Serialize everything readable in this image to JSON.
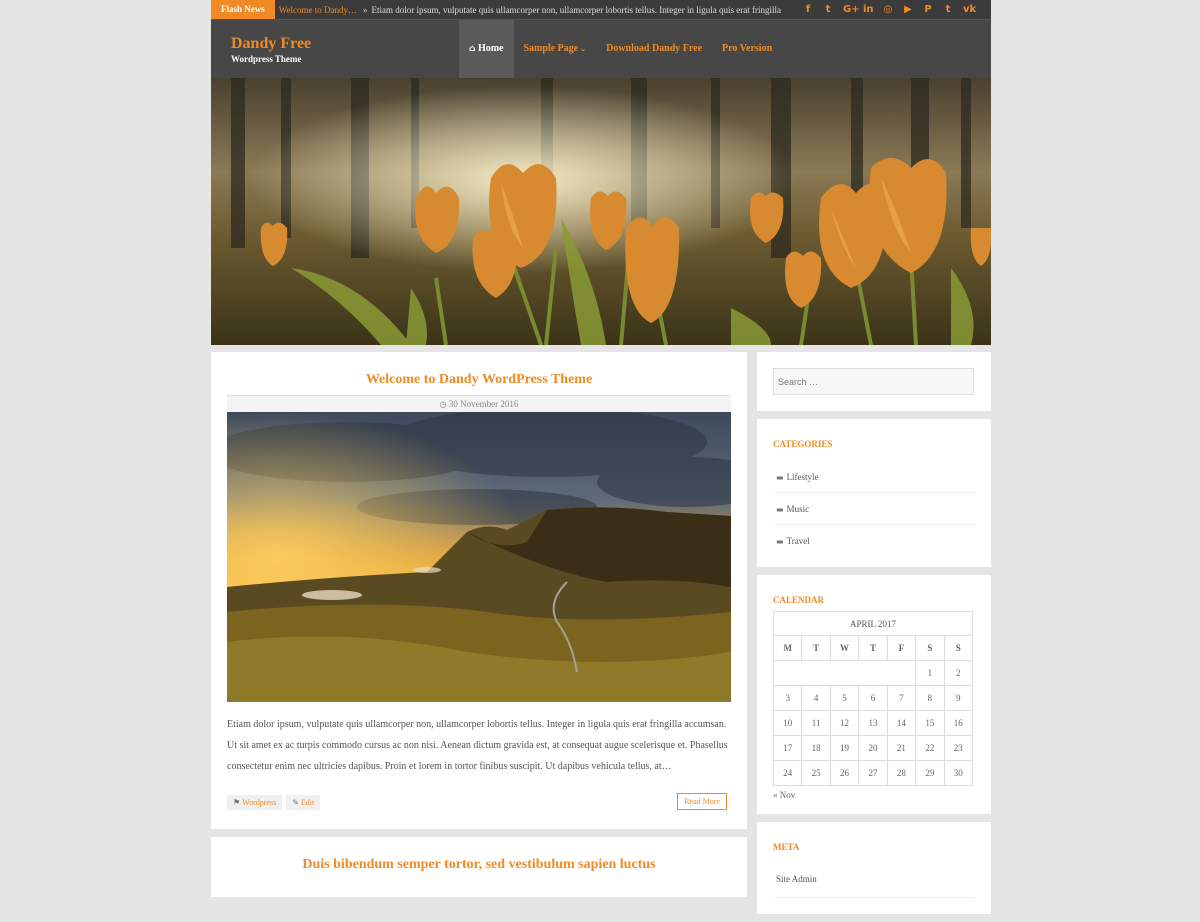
{
  "topbar": {
    "flash_label": "Flash News",
    "flash_title": "Welcome to Dandy…",
    "flash_text": "Etiam dolor ipsum, vulputate quis ullamcorper non, ullamcorper lobortis tellus. Integer in ligula quis erat fringilla",
    "socials": [
      {
        "icon": "facebook-icon",
        "glyph": "f"
      },
      {
        "icon": "twitter-icon",
        "glyph": "t"
      },
      {
        "icon": "google-plus-icon",
        "glyph": "G+"
      },
      {
        "icon": "linkedin-icon",
        "glyph": "in"
      },
      {
        "icon": "instagram-icon",
        "glyph": "◎"
      },
      {
        "icon": "youtube-icon",
        "glyph": "▶"
      },
      {
        "icon": "pinterest-icon",
        "glyph": "P"
      },
      {
        "icon": "tumblr-icon",
        "glyph": "t"
      },
      {
        "icon": "vk-icon",
        "glyph": "vk"
      }
    ]
  },
  "header": {
    "site_title": "Dandy Free",
    "site_desc": "Wordpress Theme",
    "nav": [
      {
        "label": "Home",
        "active": true
      },
      {
        "label": "Sample Page",
        "caret": "⌄"
      },
      {
        "label": "Download Dandy Free"
      },
      {
        "label": "Pro Version"
      }
    ]
  },
  "post": {
    "title": "Welcome to Dandy WordPress Theme",
    "date": "30 November 2016",
    "excerpt": "Etiam dolor ipsum, vulputate quis ullamcorper non, ullamcorper lobortis tellus. Integer in ligula quis erat fringilla accumsan. Ut sit amet ex ac turpis commodo cursus ac non nisi. Aenean dictum gravida est, at consequat augue scelerisque et. Phasellus consectetur enim nec ultricies dapibus. Proin et lorem in tortor finibus suscipit. Ut dapibus vehicula tellus, at…",
    "tag": "Wordpress",
    "edit": "Edit",
    "read_more": "Read More"
  },
  "post2": {
    "title": "Duis bibendum semper tortor, sed vestibulum sapien luctus"
  },
  "sidebar": {
    "search_placeholder": "Search …",
    "categories_title": "Categories",
    "categories": [
      "Lifestyle",
      "Music",
      "Travel"
    ],
    "calendar_title": "Calendar",
    "calendar_caption": "APRIL 2017",
    "calendar_days": [
      "M",
      "T",
      "W",
      "T",
      "F",
      "S",
      "S"
    ],
    "calendar_weeks": [
      [
        "",
        "",
        "",
        "",
        "",
        "1",
        "2"
      ],
      [
        "3",
        "4",
        "5",
        "6",
        "7",
        "8",
        "9"
      ],
      [
        "10",
        "11",
        "12",
        "13",
        "14",
        "15",
        "16"
      ],
      [
        "17",
        "18",
        "19",
        "20",
        "21",
        "22",
        "23"
      ],
      [
        "24",
        "25",
        "26",
        "27",
        "28",
        "29",
        "30"
      ]
    ],
    "calendar_prev": "« Nov",
    "meta_title": "Meta",
    "meta_items": [
      "Site Admin"
    ]
  },
  "colors": {
    "accent": "#f08a24",
    "dark": "#3b3b3b",
    "header": "#474747",
    "bg": "#e5e5e5"
  }
}
